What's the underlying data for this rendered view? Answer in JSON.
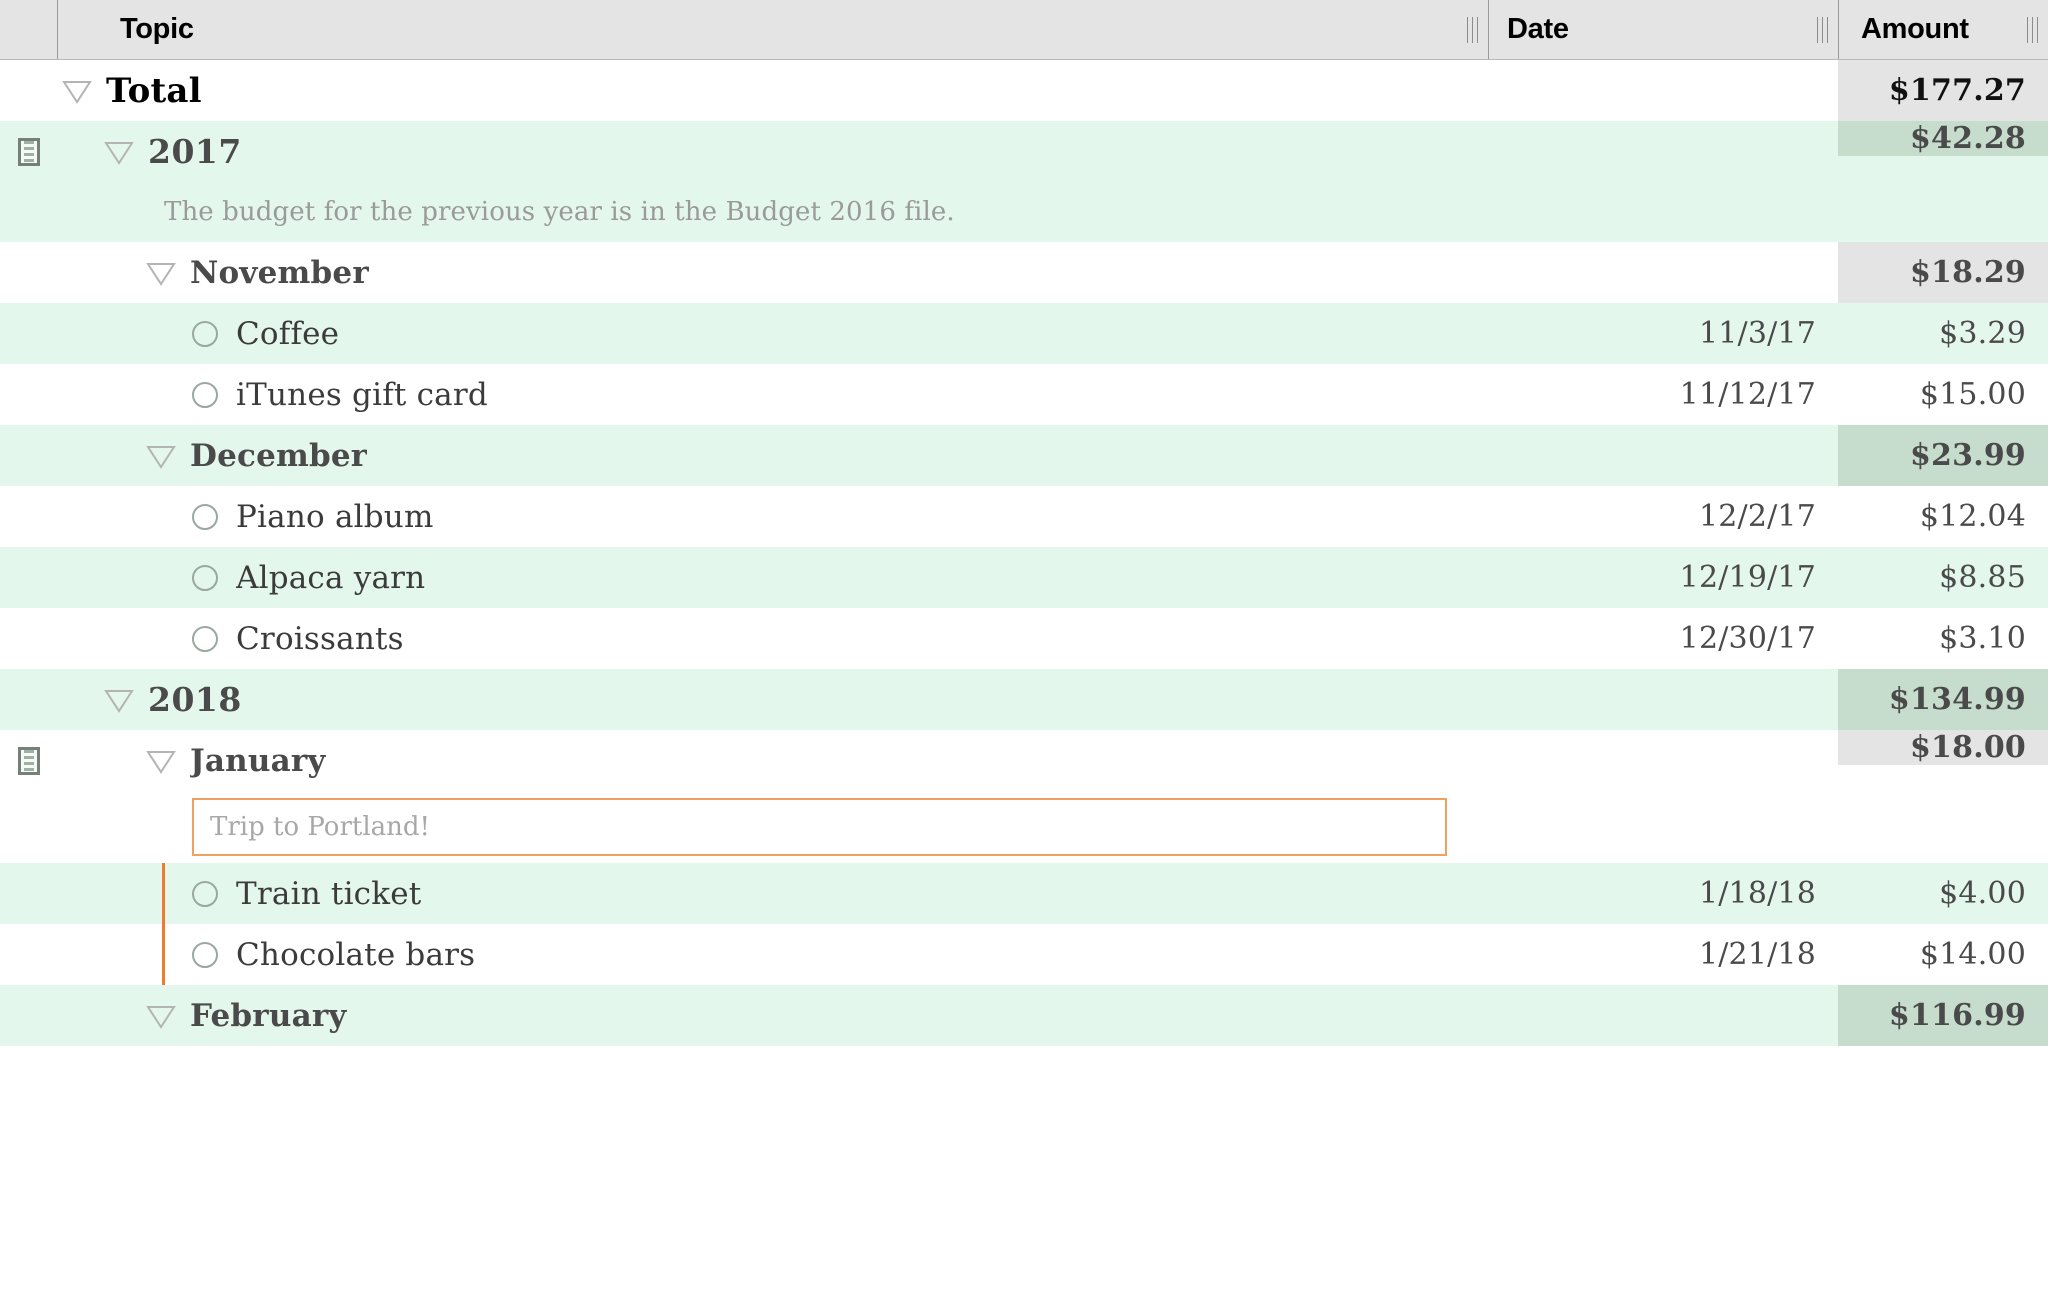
{
  "app": {
    "title": "Outline Budget Table"
  },
  "columns": {
    "topic": "Topic",
    "date": "Date",
    "amount": "Amount"
  },
  "colors": {
    "row_green": "#e4f7ec",
    "row_white": "#ffffff",
    "amount_shade_gray": "#e4e4e4",
    "amount_shade_green": "#c6dccd",
    "header_bg": "#e4e4e4",
    "accent_orange": "#f07c2a",
    "bullet_outline": "#9aa8a0",
    "note_text": "#9a9a9a"
  },
  "rows": [
    {
      "id": "total",
      "kind": "summary",
      "indent": 0,
      "band": "white",
      "has_note_icon": false,
      "disclosure": "triangle-down-icon",
      "label": "Total",
      "date": "",
      "amount": "$177.27"
    },
    {
      "id": "year-2017",
      "kind": "summary",
      "indent": 1,
      "band": "green",
      "has_note_icon": true,
      "note_icon": "note-icon",
      "disclosure": "triangle-down-icon",
      "label": "2017",
      "date": "",
      "amount": "$42.28"
    },
    {
      "id": "note-2017",
      "kind": "note",
      "indent": 2,
      "band": "green",
      "text": "The budget for the previous year is in the Budget 2016 file."
    },
    {
      "id": "month-november",
      "kind": "summary",
      "indent": 2,
      "band": "white",
      "has_note_icon": false,
      "disclosure": "triangle-down-icon",
      "label": "November",
      "date": "",
      "amount": "$18.29"
    },
    {
      "id": "item-coffee",
      "kind": "item",
      "indent": 3,
      "band": "green",
      "bullet": "circle-bullet-icon",
      "label": "Coffee",
      "date": "11/3/17",
      "amount": "$3.29"
    },
    {
      "id": "item-itunes",
      "kind": "item",
      "indent": 3,
      "band": "white",
      "bullet": "circle-bullet-icon",
      "label": "iTunes gift card",
      "date": "11/12/17",
      "amount": "$15.00"
    },
    {
      "id": "month-december",
      "kind": "summary",
      "indent": 2,
      "band": "green",
      "has_note_icon": false,
      "disclosure": "triangle-down-icon",
      "label": "December",
      "date": "",
      "amount": "$23.99"
    },
    {
      "id": "item-piano",
      "kind": "item",
      "indent": 3,
      "band": "white",
      "bullet": "circle-bullet-icon",
      "label": "Piano album",
      "date": "12/2/17",
      "amount": "$12.04"
    },
    {
      "id": "item-alpaca",
      "kind": "item",
      "indent": 3,
      "band": "green",
      "bullet": "circle-bullet-icon",
      "label": "Alpaca yarn",
      "date": "12/19/17",
      "amount": "$8.85"
    },
    {
      "id": "item-croissants",
      "kind": "item",
      "indent": 3,
      "band": "white",
      "bullet": "circle-bullet-icon",
      "label": "Croissants",
      "date": "12/30/17",
      "amount": "$3.10"
    },
    {
      "id": "year-2018",
      "kind": "summary",
      "indent": 1,
      "band": "green",
      "has_note_icon": false,
      "disclosure": "triangle-down-icon",
      "label": "2018",
      "date": "",
      "amount": "$134.99"
    },
    {
      "id": "month-january",
      "kind": "summary",
      "indent": 2,
      "band": "white",
      "has_note_icon": true,
      "note_icon": "note-icon",
      "disclosure": "triangle-down-icon",
      "label": "January",
      "date": "",
      "amount": "$18.00"
    },
    {
      "id": "note-input-january",
      "kind": "note-input",
      "indent": 2,
      "band": "white",
      "value": "",
      "placeholder": "Trip to Portland!"
    },
    {
      "id": "item-train",
      "kind": "item",
      "indent": 3,
      "band": "green",
      "bullet": "circle-bullet-icon",
      "label": "Train ticket",
      "date": "1/18/18",
      "amount": "$4.00"
    },
    {
      "id": "item-chocolate",
      "kind": "item",
      "indent": 3,
      "band": "white",
      "bullet": "circle-bullet-icon",
      "label": "Chocolate bars",
      "date": "1/21/18",
      "amount": "$14.00"
    },
    {
      "id": "month-february",
      "kind": "summary",
      "indent": 2,
      "band": "green",
      "has_note_icon": false,
      "disclosure": "triangle-down-icon",
      "label": "February",
      "date": "",
      "amount": "$116.99"
    }
  ]
}
